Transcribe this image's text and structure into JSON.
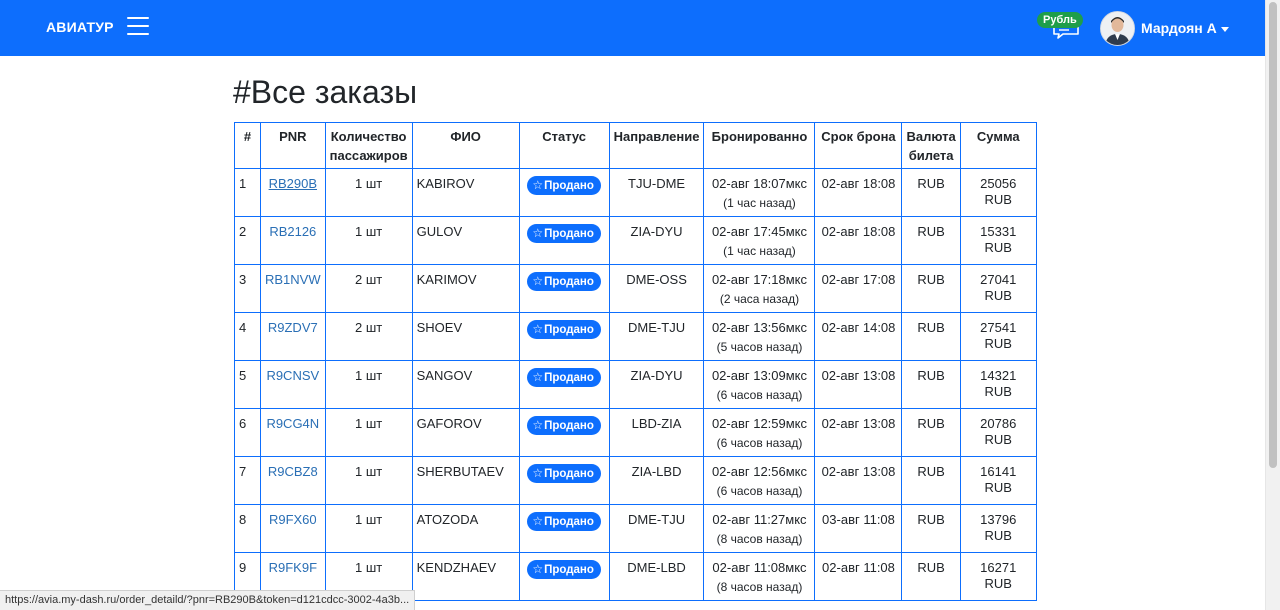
{
  "navbar": {
    "brand": "АВИАТУР",
    "currency_label": "Рубль",
    "user_name": "Мардоян А"
  },
  "page_title": "#Все заказы",
  "table": {
    "headers": [
      "#",
      "PNR",
      "Количество пассажиров",
      "ФИО",
      "Статус",
      "Направление",
      "Бронированно",
      "Срок брона",
      "Валюта билета",
      "Сумма"
    ],
    "rows": [
      {
        "num": "1",
        "pnr": "RB290B",
        "pax": "1 шт",
        "name": "KABIROV",
        "status": "Продано",
        "route": "TJU-DME",
        "booked": "02-авг 18:07мкс",
        "ago": "(1 час назад)",
        "expiry": "02-авг 18:08",
        "currency": "RUB",
        "amount": "25056 RUB"
      },
      {
        "num": "2",
        "pnr": "RB2126",
        "pax": "1 шт",
        "name": "GULOV",
        "status": "Продано",
        "route": "ZIA-DYU",
        "booked": "02-авг 17:45мкс",
        "ago": "(1 час назад)",
        "expiry": "02-авг 18:08",
        "currency": "RUB",
        "amount": "15331 RUB"
      },
      {
        "num": "3",
        "pnr": "RB1NVW",
        "pax": "2 шт",
        "name": "KARIMOV",
        "status": "Продано",
        "route": "DME-OSS",
        "booked": "02-авг 17:18мкс",
        "ago": "(2 часа назад)",
        "expiry": "02-авг 17:08",
        "currency": "RUB",
        "amount": "27041 RUB"
      },
      {
        "num": "4",
        "pnr": "R9ZDV7",
        "pax": "2 шт",
        "name": "SHOEV",
        "status": "Продано",
        "route": "DME-TJU",
        "booked": "02-авг 13:56мкс",
        "ago": "(5 часов назад)",
        "expiry": "02-авг 14:08",
        "currency": "RUB",
        "amount": "27541 RUB"
      },
      {
        "num": "5",
        "pnr": "R9CNSV",
        "pax": "1 шт",
        "name": "SANGOV",
        "status": "Продано",
        "route": "ZIA-DYU",
        "booked": "02-авг 13:09мкс",
        "ago": "(6 часов назад)",
        "expiry": "02-авг 13:08",
        "currency": "RUB",
        "amount": "14321 RUB"
      },
      {
        "num": "6",
        "pnr": "R9CG4N",
        "pax": "1 шт",
        "name": "GAFOROV",
        "status": "Продано",
        "route": "LBD-ZIA",
        "booked": "02-авг 12:59мкс",
        "ago": "(6 часов назад)",
        "expiry": "02-авг 13:08",
        "currency": "RUB",
        "amount": "20786 RUB"
      },
      {
        "num": "7",
        "pnr": "R9CBZ8",
        "pax": "1 шт",
        "name": "SHERBUTAEV",
        "status": "Продано",
        "route": "ZIA-LBD",
        "booked": "02-авг 12:56мкс",
        "ago": "(6 часов назад)",
        "expiry": "02-авг 13:08",
        "currency": "RUB",
        "amount": "16141 RUB"
      },
      {
        "num": "8",
        "pnr": "R9FX60",
        "pax": "1 шт",
        "name": "ATOZODA",
        "status": "Продано",
        "route": "DME-TJU",
        "booked": "02-авг 11:27мкс",
        "ago": "(8 часов назад)",
        "expiry": "03-авг 11:08",
        "currency": "RUB",
        "amount": "13796 RUB"
      },
      {
        "num": "9",
        "pnr": "R9FK9F",
        "pax": "1 шт",
        "name": "KENDZHAEV",
        "status": "Продано",
        "route": "DME-LBD",
        "booked": "02-авг 11:08мкс",
        "ago": "(8 часов назад)",
        "expiry": "02-авг 11:08",
        "currency": "RUB",
        "amount": "16271 RUB"
      }
    ]
  },
  "status_bar_url": "https://avia.my-dash.ru/order_detaild/?pnr=RB290B&token=d121cdcc-3002-4a3b...",
  "colors": {
    "navbar": "#0d6efd",
    "badge": "#0d6efd",
    "currency_badge": "#1e9e4a",
    "link": "#2a6fb5"
  }
}
